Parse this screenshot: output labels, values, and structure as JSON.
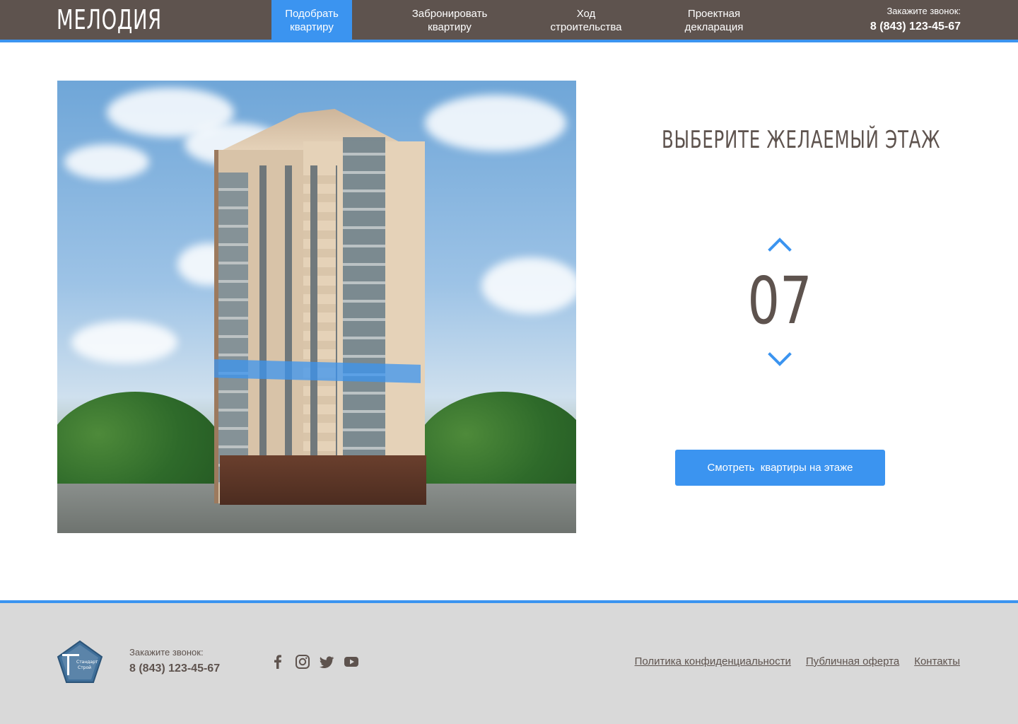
{
  "header": {
    "logo": "МЕЛОДИЯ",
    "nav": [
      {
        "label": "Подобрать\nквартиру",
        "active": true
      },
      {
        "label": "Забронировать\nквартиру",
        "active": false
      },
      {
        "label": "Ход\nстроительства",
        "active": false
      },
      {
        "label": "Проектная\nдекларация",
        "active": false
      }
    ],
    "call_label": "Закажите звонок:",
    "phone": "8 (843) 123-45-67"
  },
  "main": {
    "title": "ВЫБЕРИТЕ ЖЕЛАЕМЫЙ ЭТАЖ",
    "floor": "07",
    "button_label": "Смотреть  квартиры на этаже",
    "up_icon": "chevron-up-icon",
    "down_icon": "chevron-down-icon"
  },
  "footer": {
    "logo_text": "Стандарт Строй",
    "call_label": "Закажите звонок:",
    "phone": "8 (843) 123-45-67",
    "social": [
      "facebook-icon",
      "instagram-icon",
      "twitter-icon",
      "youtube-icon"
    ],
    "links": [
      "Политика конфиденциальности",
      "Публичная оферта",
      "Контакты"
    ]
  },
  "colors": {
    "header_bg": "#5e534e",
    "accent": "#3b94f0",
    "footer_bg": "#d9d9d9",
    "text": "#5e534e"
  }
}
